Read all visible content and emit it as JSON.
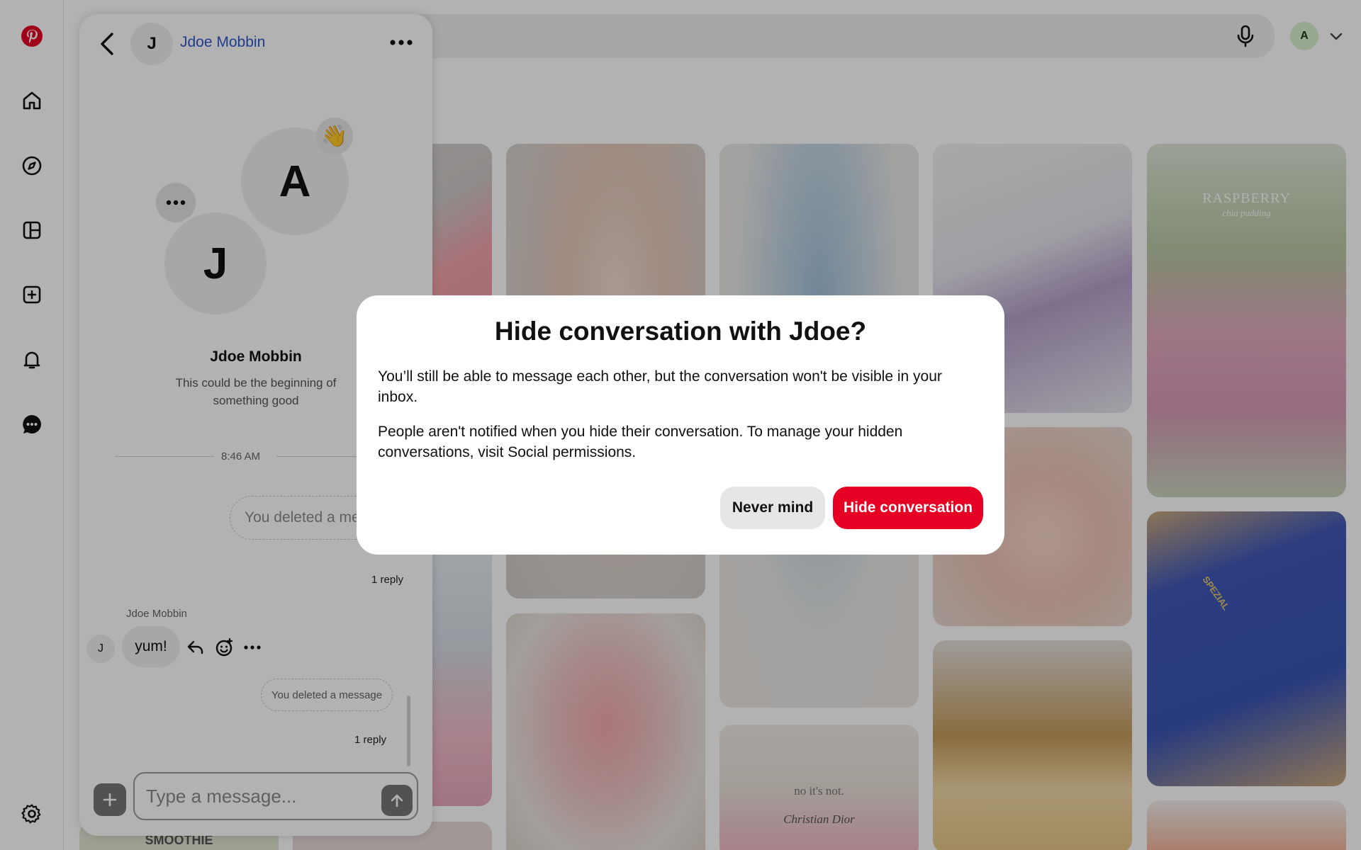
{
  "colors": {
    "brand": "#e60023",
    "link": "#3056c9",
    "overlay": "rgba(0,0,0,0.3)"
  },
  "rail": {
    "icons": [
      "pinterest-logo",
      "home-icon",
      "explore-icon",
      "boards-icon",
      "create-icon",
      "bell-icon",
      "messages-icon",
      "settings-icon"
    ]
  },
  "topbar": {
    "account_initial": "A"
  },
  "pins": [
    {
      "subject": "strawberry cake",
      "caption": ""
    },
    {
      "subject": "chrome nails",
      "caption": ""
    },
    {
      "subject": "blue heels",
      "caption": ""
    },
    {
      "subject": "books and crystal",
      "caption": ""
    },
    {
      "subject": "raspberry chia pudding",
      "caption": "RASPBERRY",
      "subcaption": "chia pudding"
    },
    {
      "subject": "french manicure",
      "caption": ""
    },
    {
      "subject": "blue sneakers",
      "caption": "SPEZIAL"
    },
    {
      "subject": "pink flowers",
      "caption": ""
    },
    {
      "subject": "crepe cake",
      "caption": ""
    },
    {
      "subject": "dior bag",
      "caption": "no it's not.",
      "subcaption": "Christian Dior"
    },
    {
      "subject": "smoothie",
      "caption": "SMOOTHIE"
    },
    {
      "subject": "pink tweezers",
      "caption": ""
    }
  ],
  "chat": {
    "header_initial": "J",
    "header_name": "Jdoe Mobbin",
    "profile_initial_a": "A",
    "profile_initial_j": "J",
    "wave_emoji": "👋",
    "profile_name": "Jdoe Mobbin",
    "profile_subtitle": "This could be the beginning of something good",
    "timestamp": "8:46 AM",
    "messages": [
      {
        "text": "You deleted a message",
        "replies": "1 reply"
      },
      {
        "sender": "Jdoe Mobbin",
        "sender_initial": "J",
        "text": "yum!"
      },
      {
        "text": "You deleted a message",
        "replies": "1 reply"
      }
    ],
    "input_placeholder": "Type a message..."
  },
  "modal": {
    "title": "Hide conversation with Jdoe?",
    "paragraph1": "You’ll still be able to message each other, but the conversation won't be visible in your inbox.",
    "paragraph2": "People aren't notified when you hide their conversation. To manage your hidden conversations, visit Social permissions.",
    "cancel_label": "Never mind",
    "confirm_label": "Hide conversation"
  }
}
